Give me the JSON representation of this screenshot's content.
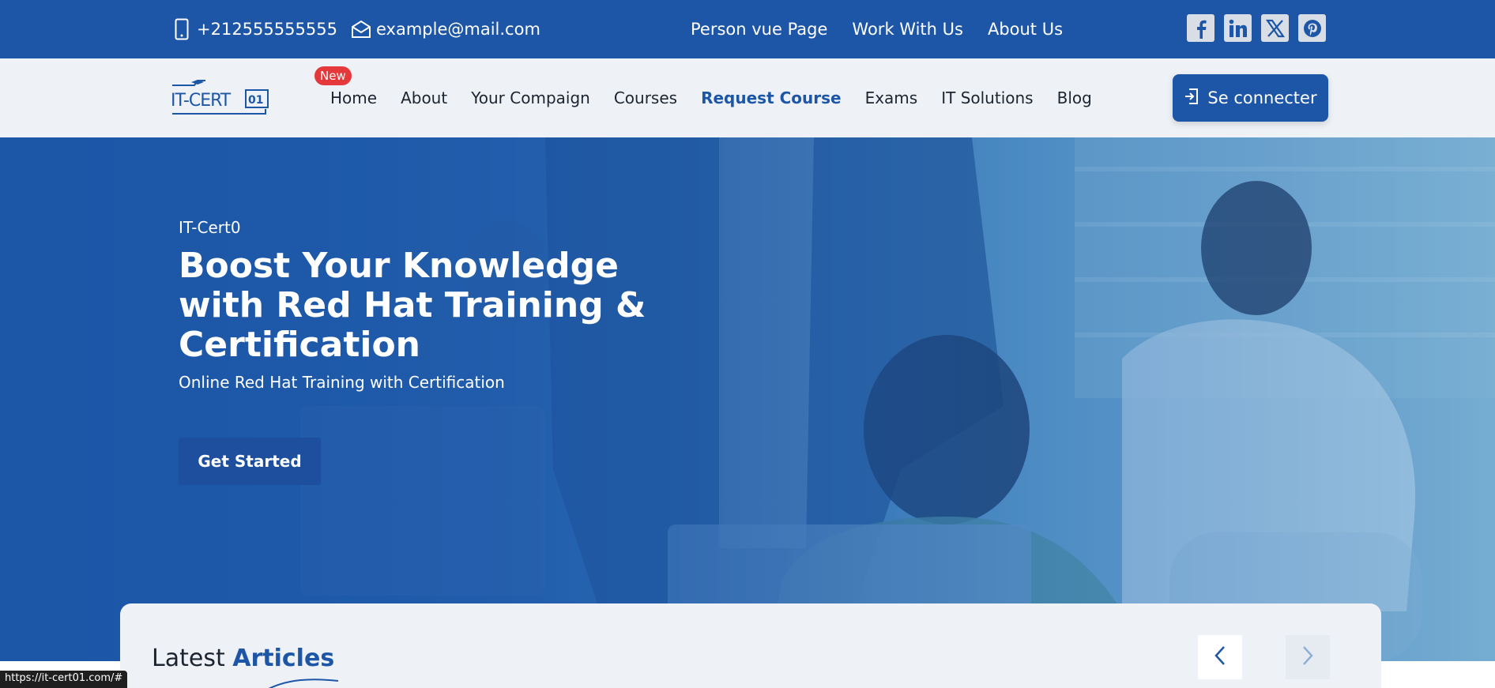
{
  "topbar": {
    "phone": "+212555555555",
    "email": "example@mail.com",
    "links": [
      "Person vue Page",
      "Work With Us",
      "About Us"
    ],
    "socials": [
      "facebook-icon",
      "linkedin-icon",
      "x-icon",
      "pinterest-icon"
    ]
  },
  "navbar": {
    "logo_text": "IT-CERT01",
    "badge": "New",
    "items": [
      {
        "label": "Home"
      },
      {
        "label": "About"
      },
      {
        "label": "Your Compaign"
      },
      {
        "label": "Courses"
      },
      {
        "label": "Request Course"
      },
      {
        "label": "Exams"
      },
      {
        "label": "IT Solutions"
      },
      {
        "label": "Blog"
      }
    ],
    "login_label": "Se connecter"
  },
  "hero": {
    "eyebrow": "IT-Cert0",
    "title": "Boost Your Knowledge with Red Hat Training & Certification",
    "subtitle": "Online Red Hat Training with Certification",
    "cta": "Get Started"
  },
  "articles": {
    "title_plain": "Latest",
    "title_highlight": "Articles"
  },
  "status_bar": {
    "url": "https://it-cert01.com/#"
  },
  "colors": {
    "primary": "#1d56a6",
    "nav_bg": "#eef2f6",
    "badge": "#e5383b"
  }
}
